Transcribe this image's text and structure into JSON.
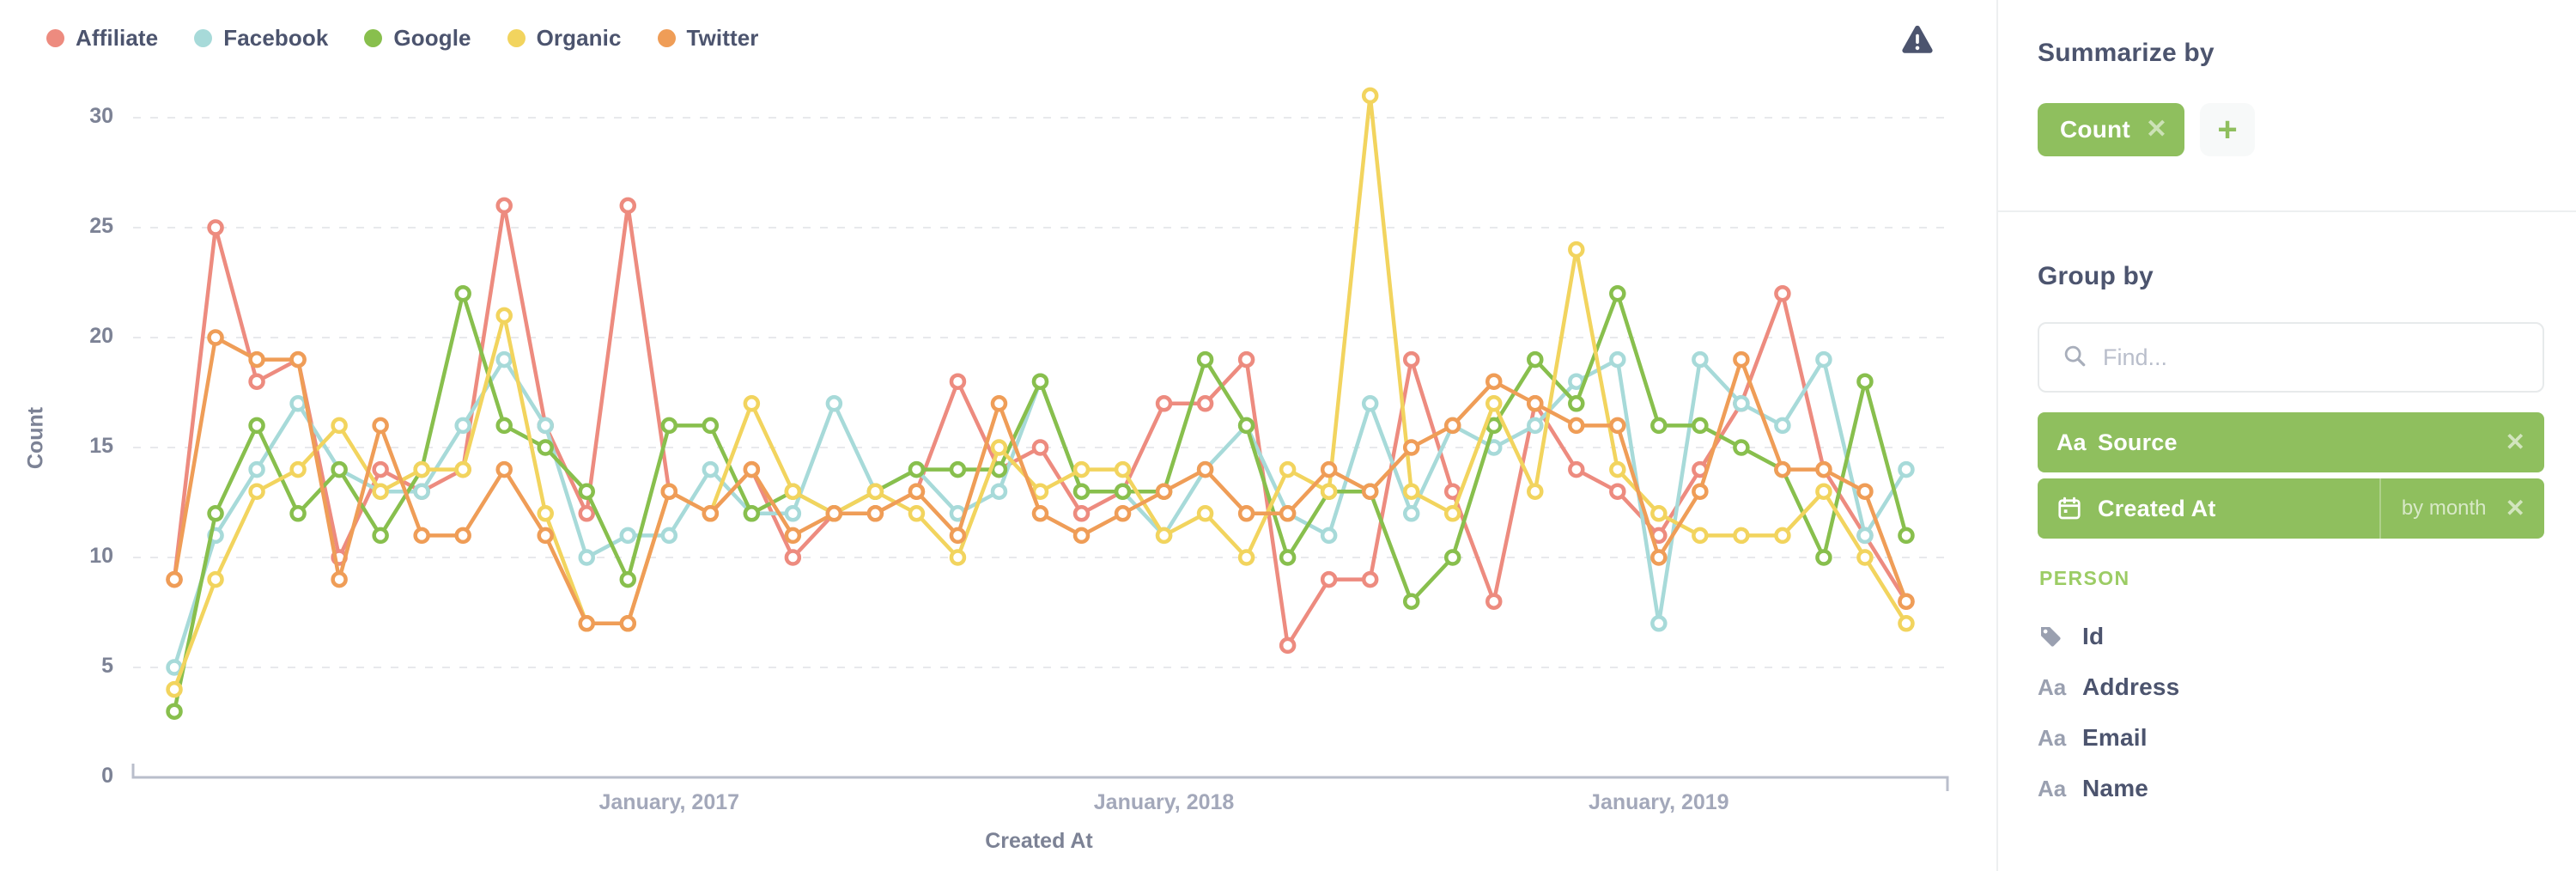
{
  "legend": {
    "items": [
      {
        "label": "Affiliate",
        "color": "#ED8B7F"
      },
      {
        "label": "Facebook",
        "color": "#A7DAD9"
      },
      {
        "label": "Google",
        "color": "#88BF4D"
      },
      {
        "label": "Organic",
        "color": "#F2D45E"
      },
      {
        "label": "Twitter",
        "color": "#EF9D57"
      }
    ]
  },
  "warning": {
    "icon": "warning-triangle-icon",
    "color": "#4C546E"
  },
  "chart_data": {
    "type": "line",
    "title": "",
    "xlabel": "Created At",
    "ylabel": "Count",
    "ylim": [
      0,
      31
    ],
    "yticks": [
      0,
      5,
      10,
      15,
      20,
      25,
      30
    ],
    "xtick_labels": [
      "January, 2017",
      "January, 2018",
      "January, 2019"
    ],
    "xtick_positions": [
      12,
      24,
      36
    ],
    "grid": true,
    "legend_position": "top-left",
    "n_points": 43,
    "series": [
      {
        "name": "Affiliate",
        "color": "#ED8B7F",
        "values": [
          9,
          25,
          18,
          19,
          10,
          14,
          13,
          14,
          26,
          16,
          12,
          26,
          13,
          12,
          14,
          10,
          12,
          12,
          13,
          18,
          14,
          15,
          12,
          13,
          17,
          17,
          19,
          6,
          9,
          9,
          19,
          13,
          8,
          17,
          14,
          13,
          11,
          14,
          17,
          22,
          14,
          11,
          8
        ]
      },
      {
        "name": "Facebook",
        "color": "#A7DAD9",
        "values": [
          5,
          11,
          14,
          17,
          14,
          13,
          13,
          16,
          19,
          16,
          10,
          11,
          11,
          14,
          12,
          12,
          17,
          13,
          14,
          12,
          13,
          18,
          13,
          13,
          11,
          14,
          16,
          12,
          11,
          17,
          12,
          16,
          15,
          16,
          18,
          19,
          7,
          19,
          17,
          16,
          19,
          11,
          14
        ]
      },
      {
        "name": "Google",
        "color": "#88BF4D",
        "values": [
          3,
          12,
          16,
          12,
          14,
          11,
          14,
          22,
          16,
          15,
          13,
          9,
          16,
          16,
          12,
          13,
          12,
          13,
          14,
          14,
          14,
          18,
          13,
          13,
          13,
          19,
          16,
          10,
          13,
          13,
          8,
          10,
          16,
          19,
          17,
          22,
          16,
          16,
          15,
          14,
          10,
          18,
          11
        ]
      },
      {
        "name": "Organic",
        "color": "#F2D45E",
        "values": [
          4,
          9,
          13,
          14,
          16,
          13,
          14,
          14,
          21,
          12,
          7,
          7,
          13,
          12,
          17,
          13,
          12,
          13,
          12,
          10,
          15,
          13,
          14,
          14,
          11,
          12,
          10,
          14,
          13,
          31,
          13,
          12,
          17,
          13,
          24,
          14,
          12,
          11,
          11,
          11,
          13,
          10,
          7
        ]
      },
      {
        "name": "Twitter",
        "color": "#EF9D57",
        "values": [
          9,
          20,
          19,
          19,
          9,
          16,
          11,
          11,
          14,
          11,
          7,
          7,
          13,
          12,
          14,
          11,
          12,
          12,
          13,
          11,
          17,
          12,
          11,
          12,
          13,
          14,
          12,
          12,
          14,
          13,
          15,
          16,
          18,
          17,
          16,
          16,
          10,
          13,
          19,
          14,
          14,
          13,
          8
        ]
      }
    ]
  },
  "sidebar": {
    "summarize": {
      "heading": "Summarize by",
      "chips": [
        {
          "label": "Count",
          "remove_icon": "close-icon"
        }
      ],
      "add_label": "+"
    },
    "groupby": {
      "heading": "Group by",
      "search_placeholder": "Find...",
      "search_value": "",
      "search_icon": "search-icon",
      "chips": [
        {
          "label": "Source",
          "icon": "text-type-icon",
          "icon_glyph": "Aa",
          "sub": "",
          "remove_icon": "close-icon"
        },
        {
          "label": "Created At",
          "icon": "calendar-icon",
          "icon_glyph": "",
          "sub": "by month",
          "remove_icon": "close-icon"
        }
      ]
    },
    "fields": {
      "group_label": "PERSON",
      "group_color": "#9CCC65",
      "items": [
        {
          "label": "Id",
          "icon": "tag-icon",
          "glyph": ""
        },
        {
          "label": "Address",
          "icon": "text-type-icon",
          "glyph": "Aa"
        },
        {
          "label": "Email",
          "icon": "text-type-icon",
          "glyph": "Aa"
        },
        {
          "label": "Name",
          "icon": "text-type-icon",
          "glyph": "Aa"
        }
      ]
    }
  }
}
